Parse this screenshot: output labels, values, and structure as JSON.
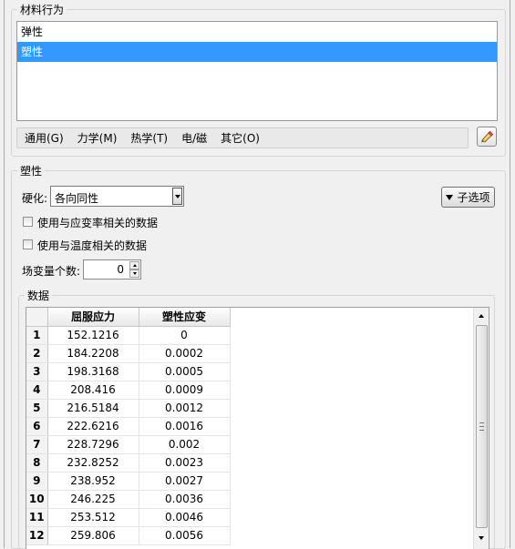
{
  "behavior_group": {
    "title": "材料行为",
    "items": [
      {
        "label": "弹性",
        "selected": false
      },
      {
        "label": "塑性",
        "selected": true
      }
    ]
  },
  "menu": {
    "items": [
      "通用(G)",
      "力学(M)",
      "热学(T)",
      "电/磁",
      "其它(O)"
    ],
    "edit_icon": "pencil-eraser-icon"
  },
  "plastic_group": {
    "title": "塑性",
    "hardening_label": "硬化:",
    "hardening_value": "各向同性",
    "suboptions_label": "子选项",
    "strain_rate_label": "使用与应变率相关的数据",
    "temperature_label": "使用与温度相关的数据",
    "field_vars_label": "场变量个数:",
    "field_vars_value": "0"
  },
  "data_group": {
    "title": "数据",
    "columns": [
      "屈服应力",
      "塑性应变"
    ],
    "rows": [
      {
        "n": "1",
        "stress": "152.1216",
        "strain": "0"
      },
      {
        "n": "2",
        "stress": "184.2208",
        "strain": "0.0002"
      },
      {
        "n": "3",
        "stress": "198.3168",
        "strain": "0.0005"
      },
      {
        "n": "4",
        "stress": "208.416",
        "strain": "0.0009"
      },
      {
        "n": "5",
        "stress": "216.5184",
        "strain": "0.0012"
      },
      {
        "n": "6",
        "stress": "222.6216",
        "strain": "0.0016"
      },
      {
        "n": "7",
        "stress": "228.7296",
        "strain": "0.002"
      },
      {
        "n": "8",
        "stress": "232.8252",
        "strain": "0.0023"
      },
      {
        "n": "9",
        "stress": "238.952",
        "strain": "0.0027"
      },
      {
        "n": "10",
        "stress": "246.225",
        "strain": "0.0036"
      },
      {
        "n": "11",
        "stress": "253.512",
        "strain": "0.0046"
      },
      {
        "n": "12",
        "stress": "259.806",
        "strain": "0.0056"
      }
    ]
  },
  "colors": {
    "selection": "#3399ff",
    "background": "#f0f0f0"
  }
}
